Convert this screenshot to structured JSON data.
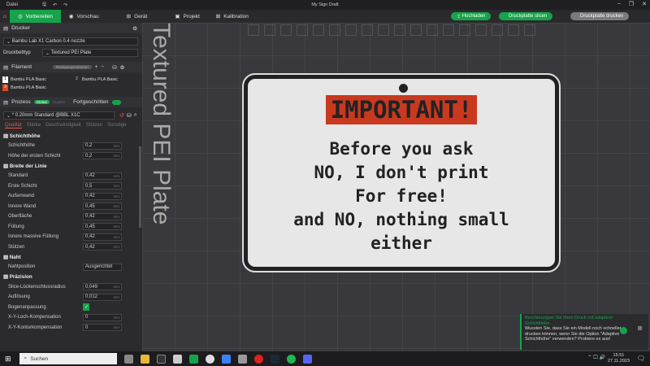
{
  "window": {
    "title": "My Sign Draft",
    "menu": "Datei"
  },
  "tabs": [
    {
      "label": "Vorbereiten"
    },
    {
      "label": "Vorschau"
    },
    {
      "label": "Gerät"
    },
    {
      "label": "Projekt"
    },
    {
      "label": "Kalibration"
    }
  ],
  "actions": {
    "upload": "Hochladen",
    "slice": "Druckplatte slicen",
    "print": "Druckplatte drucken"
  },
  "printer": {
    "header": "Drucker",
    "name": "Bambu Lab X1 Carbon 0.4 nozzle",
    "bed_label": "Druckbetttyp",
    "bed_value": "Textured PEI Plate"
  },
  "filament": {
    "header": "Filament",
    "cleaning": "Reinigungsvolumen",
    "items": [
      {
        "num": "1",
        "name": "Bambu PLA Basic",
        "color": "#ffffff"
      },
      {
        "num": "2",
        "name": "Bambu PLA Basic",
        "color": "#333333"
      },
      {
        "num": "3",
        "name": "Bambu PLA Basic",
        "color": "#e0461e"
      }
    ]
  },
  "process": {
    "header": "Prozess",
    "global": "Global",
    "objects": "Objekte",
    "advanced": "Fortgeschritten",
    "preset": "* 0.20mm Standard @BBL X1C",
    "tabs": [
      "Qualität",
      "Stärke",
      "Geschwindigkeit",
      "Stützen",
      "Sonstige"
    ],
    "groups": [
      {
        "title": "Schichthöhe",
        "params": [
          {
            "label": "Schichthöhe",
            "value": "0,2",
            "unit": "mm"
          },
          {
            "label": "Höhe der ersten Schicht",
            "value": "0,2",
            "unit": "mm"
          }
        ]
      },
      {
        "title": "Breite der Linie",
        "params": [
          {
            "label": "Standard",
            "value": "0,42",
            "unit": "mm"
          },
          {
            "label": "Erste Schicht",
            "value": "0,5",
            "unit": "mm"
          },
          {
            "label": "Außenwand",
            "value": "0,42",
            "unit": "mm"
          },
          {
            "label": "Innere Wand",
            "value": "0,45",
            "unit": "mm"
          },
          {
            "label": "Oberfläche",
            "value": "0,42",
            "unit": "mm"
          },
          {
            "label": "Füllung",
            "value": "0,45",
            "unit": "mm"
          },
          {
            "label": "Innere massive Füllung",
            "value": "0,42",
            "unit": "mm"
          },
          {
            "label": "Stützen",
            "value": "0,42",
            "unit": "mm"
          }
        ]
      },
      {
        "title": "Naht",
        "params": [
          {
            "label": "Nahtposition",
            "value": "Ausgerichtet",
            "unit": ""
          }
        ]
      },
      {
        "title": "Präzision",
        "params": [
          {
            "label": "Slice-Lückenschlussradius",
            "value": "0,049",
            "unit": "mm"
          },
          {
            "label": "Auflösung",
            "value": "0,012",
            "unit": "mm"
          },
          {
            "label": "Bogenanpassung",
            "value": "✓",
            "unit": ""
          },
          {
            "label": "X-Y-Loch-Kompensation",
            "value": "0",
            "unit": "mm"
          },
          {
            "label": "X-Y-Konturkompensation",
            "value": "0",
            "unit": "mm"
          }
        ]
      }
    ]
  },
  "viewport": {
    "bed_label": "Textured PEI Plate"
  },
  "sign": {
    "headline": "IMPORTANT!",
    "lines": [
      "Before you ask",
      "NO, I don't print",
      "For free!",
      "and NO, nothing small",
      "either"
    ]
  },
  "toast": {
    "title": "Beschleunigen Sie Ihren Druck mit adaptiver Schichthöhe",
    "body": "Wussten Sie, dass Sie ein Modell noch schneller drucken können, wenn Sie die Option \"Adaptive Schichthöhe\" verwenden? Probiere es aus!"
  },
  "taskbar": {
    "search": "Suchen",
    "time": "15:51",
    "date": "27.11.2023"
  }
}
